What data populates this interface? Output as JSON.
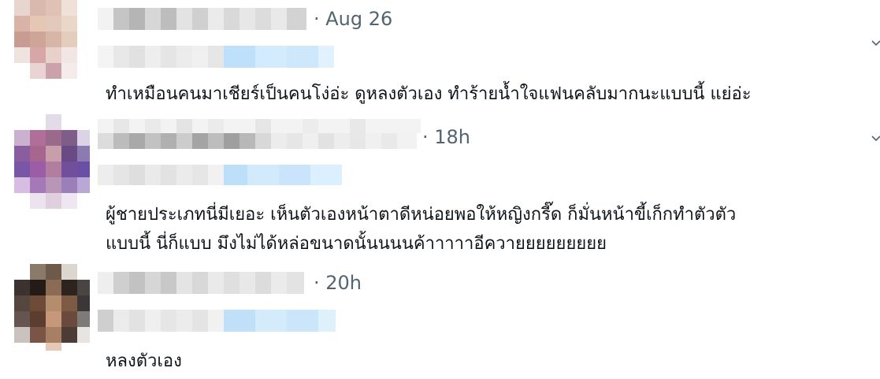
{
  "replies": [
    {
      "timestamp": "· Aug 26",
      "text_lines": [
        "ทำเหมือนคนมาเชียร์เป็นคนโง่อ่ะ ดูหลงตัวเอง ทำร้ายน้ำใจแฟนคลับมากนะแบบนี้ แย่อ่ะ"
      ]
    },
    {
      "timestamp": "· 18h",
      "text_lines": [
        "ผู้ชายประเภทนี่มีเยอะ เห็นตัวเองหน้าตาดีหน่อยพอให้หญิงกรี๊ด ก็มั่นหน้าขี้เก็กทำตัวตัว",
        "แบบนี้  นี่ก็แบบ มึงไม่ได้หล่อขนาดนั้นนนนค้าาาาาอีควายยยยยยยยย"
      ]
    },
    {
      "timestamp": "· 20h",
      "text_lines": [
        "หลงตัวเอง"
      ]
    }
  ],
  "icons": {
    "more": "chevron-down-icon",
    "avatar": "pixelated-avatar-icon"
  },
  "colors": {
    "text": "#0f1419",
    "muted": "#536471",
    "mention_blur": "#cfe7fb"
  }
}
